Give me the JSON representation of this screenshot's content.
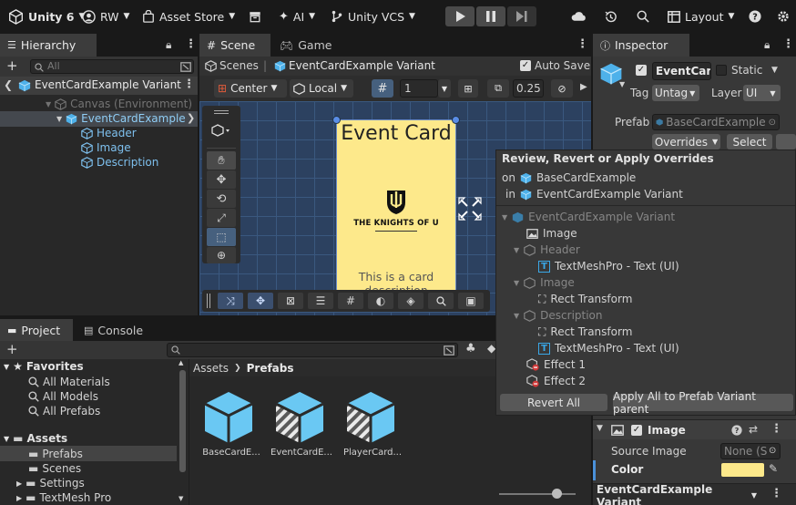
{
  "toolbar": {
    "app_name": "Unity 6",
    "account": "RW",
    "asset_store": "Asset Store",
    "ai": "AI",
    "vcs": "Unity VCS",
    "layout": "Layout"
  },
  "hierarchy": {
    "tab": "Hierarchy",
    "search_placeholder": "All",
    "context": "EventCardExample Variant",
    "items": [
      {
        "label": "Canvas (Environment)"
      },
      {
        "label": "EventCardExample"
      },
      {
        "label": "Header"
      },
      {
        "label": "Image"
      },
      {
        "label": "Description"
      }
    ]
  },
  "scene": {
    "tab_scene": "Scene",
    "tab_game": "Game",
    "breadcrumb_root": "Scenes",
    "breadcrumb_leaf": "EventCardExample Variant",
    "auto_save": "Auto Save",
    "pivot": "Center",
    "space": "Local",
    "grid_value": "1",
    "snap_value": "0.25",
    "card_title": "Event Card",
    "card_logo_text": "THE KNIGHTS OF U",
    "card_body": "This is a card description"
  },
  "inspector": {
    "tab": "Inspector",
    "object_name": "EventCar",
    "static_label": "Static",
    "tag_label": "Tag",
    "tag_value": "Untag",
    "layer_label": "Layer",
    "layer_value": "UI",
    "prefab_label": "Prefab",
    "prefab_value": "BaseCardExample",
    "overrides": "Overrides",
    "select": "Select",
    "image_component": "Image",
    "source_image_label": "Source Image",
    "source_image_value": "None (S",
    "color_label": "Color",
    "color_value": "#FDE98B",
    "bottom_bar": "EventCardExample Variant"
  },
  "overrides_popup": {
    "title": "Review, Revert or Apply Overrides",
    "on_label": "on",
    "on_value": "BaseCardExample",
    "in_label": "in",
    "in_value": "EventCardExample Variant",
    "tree": [
      {
        "label": "EventCardExample Variant"
      },
      {
        "label": "Image"
      },
      {
        "label": "Header"
      },
      {
        "label": "TextMeshPro - Text (UI)"
      },
      {
        "label": "Image"
      },
      {
        "label": "Rect Transform"
      },
      {
        "label": "Description"
      },
      {
        "label": "Rect Transform"
      },
      {
        "label": "TextMeshPro - Text (UI)"
      },
      {
        "label": "Effect 1"
      },
      {
        "label": "Effect 2"
      }
    ],
    "revert_all": "Revert All",
    "apply_all": "Apply All to Prefab Variant parent"
  },
  "project": {
    "tab_project": "Project",
    "tab_console": "Console",
    "favorites": "Favorites",
    "fav_items": [
      {
        "label": "All Materials"
      },
      {
        "label": "All Models"
      },
      {
        "label": "All Prefabs"
      }
    ],
    "assets": "Assets",
    "asset_folders": [
      {
        "label": "Prefabs"
      },
      {
        "label": "Scenes"
      },
      {
        "label": "Settings"
      },
      {
        "label": "TextMesh Pro"
      }
    ],
    "breadcrumb_root": "Assets",
    "breadcrumb_leaf": "Prefabs",
    "files": [
      {
        "label": "BaseCardE..."
      },
      {
        "label": "EventCardE..."
      },
      {
        "label": "PlayerCard..."
      }
    ]
  }
}
